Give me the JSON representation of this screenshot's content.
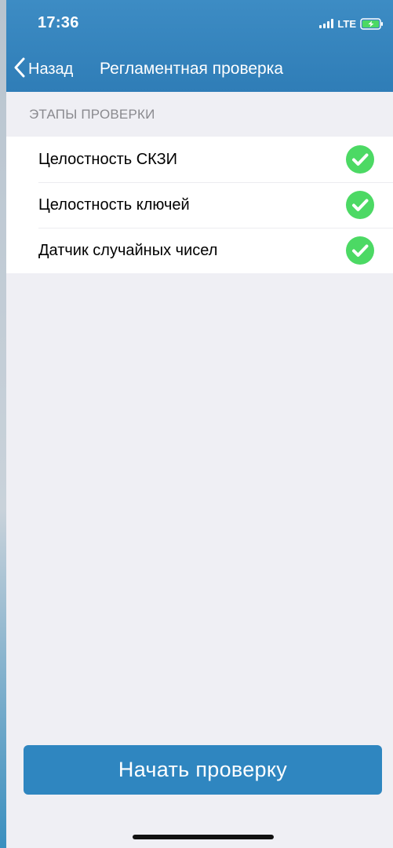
{
  "status_bar": {
    "time": "17:36",
    "network": "LTE",
    "icons": [
      "signal-icon",
      "battery-charging-icon"
    ]
  },
  "nav": {
    "back_label": "Назад",
    "title": "Регламентная проверка",
    "back_icon": "chevron-left-icon"
  },
  "section": {
    "header": "ЭТАПЫ ПРОВЕРКИ"
  },
  "checks": [
    {
      "label": "Целостность СКЗИ",
      "status": "passed",
      "icon": "check-circle-icon"
    },
    {
      "label": "Целостность ключей",
      "status": "passed",
      "icon": "check-circle-icon"
    },
    {
      "label": "Датчик случайных чисел",
      "status": "passed",
      "icon": "check-circle-icon"
    }
  ],
  "actions": {
    "start_label": "Начать проверку"
  },
  "colors": {
    "header": "#2f7db7",
    "button": "#2f86c0",
    "success": "#4cd964",
    "background": "#efeff4",
    "section_text": "#8a8a8f"
  }
}
